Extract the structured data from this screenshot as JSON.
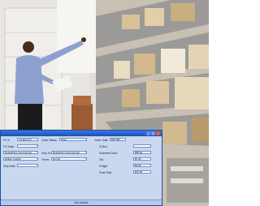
{
  "form": {
    "left": {
      "po_label": "PO #:",
      "po_value": "Created On",
      "po_date_label": "PO Date:",
      "po_date_value": "",
      "vendor_label": "",
      "vendor_value": "Networking Components",
      "delivery_label": "",
      "delivery_value": "Deliver Freight",
      "ship_date_label": "Ship Date:",
      "ship_date_value": ""
    },
    "middle": {
      "order_status_label": "Order Status:",
      "order_status_value": "Open",
      "ship_to_label": "Ship To:",
      "ship_to_value": "Networking Components",
      "terms_label": "Terms:",
      "terms_value": "Net 30"
    },
    "right": {
      "order_total_label": "Order Total:",
      "order_total_value": "$68,000",
      "s_disc_label": "S Disc:",
      "s_disc_value": "",
      "subtotal_label": "Extended Total:",
      "subtotal_value": "$68.00",
      "tax_label": "Tax:",
      "tax_value": "$7.00",
      "freight_label": "Freight:",
      "freight_value": "$0.00",
      "total_label": "Final Total:",
      "total_value": "$75.00"
    }
  },
  "status_bar": {
    "text": "Not Locked"
  },
  "colors": {
    "titlebar": "#1b4fb8",
    "window_bg": "#c9d8ee",
    "close": "#d9532c"
  }
}
